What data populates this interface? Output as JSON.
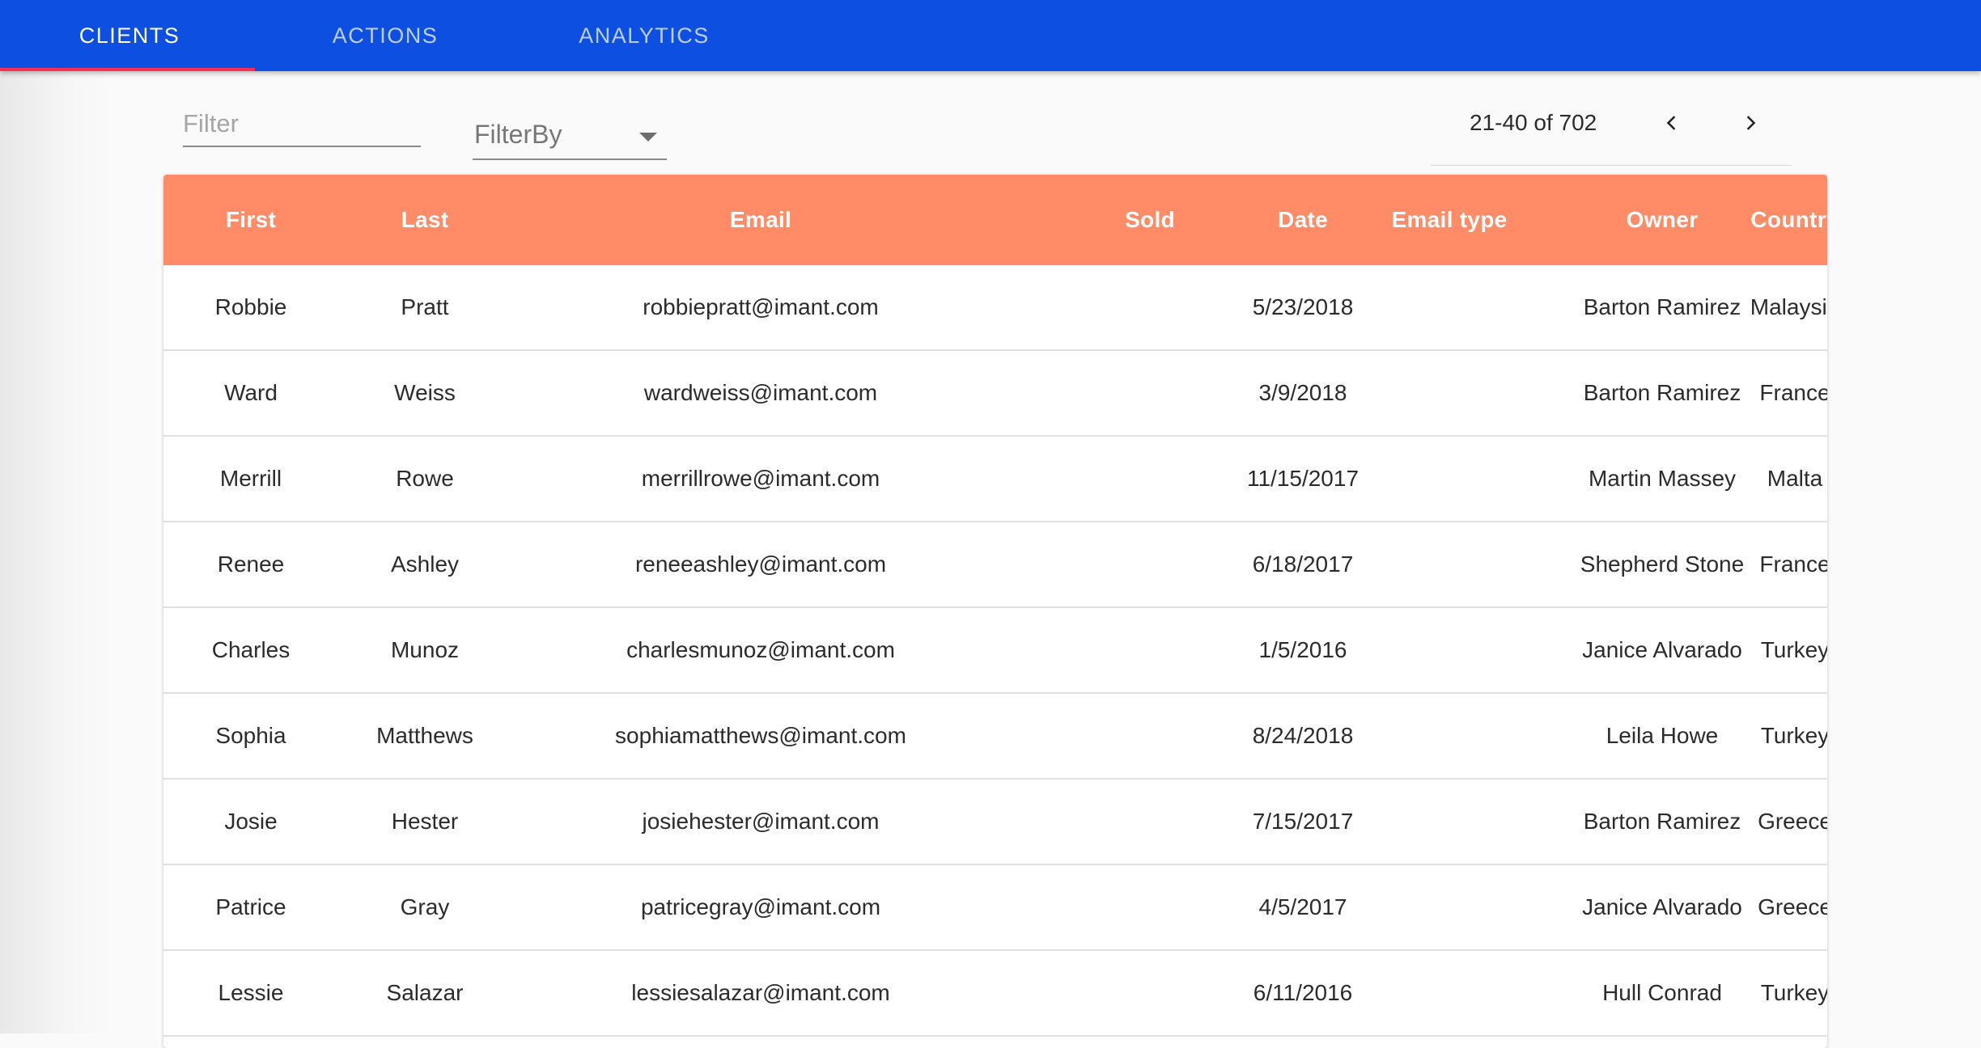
{
  "tabs": [
    {
      "label": "CLIENTS",
      "active": true
    },
    {
      "label": "ACTIONS",
      "active": false
    },
    {
      "label": "ANALYTICS",
      "active": false
    }
  ],
  "controls": {
    "filter_placeholder": "Filter",
    "filter_by_label": "FilterBy",
    "pagination_range": "21-40 of 702"
  },
  "colors": {
    "appbar": "#0d4fe0",
    "tab_indicator": "#ff2d55",
    "table_header": "#ff8c66"
  },
  "icons": {
    "prev": "chevron-left-icon",
    "next": "chevron-right-icon",
    "select": "caret-down-icon"
  },
  "table": {
    "columns": [
      "First",
      "Last",
      "Email",
      "Sold",
      "Date",
      "Email type",
      "Owner",
      "Country"
    ],
    "rows": [
      {
        "first": "Robbie",
        "last": "Pratt",
        "email": "robbiepratt@imant.com",
        "sold": "",
        "date": "5/23/2018",
        "email_type": "",
        "owner": "Barton Ramirez",
        "country": "Malaysia"
      },
      {
        "first": "Ward",
        "last": "Weiss",
        "email": "wardweiss@imant.com",
        "sold": "",
        "date": "3/9/2018",
        "email_type": "",
        "owner": "Barton Ramirez",
        "country": "France"
      },
      {
        "first": "Merrill",
        "last": "Rowe",
        "email": "merrillrowe@imant.com",
        "sold": "",
        "date": "11/15/2017",
        "email_type": "",
        "owner": "Martin Massey",
        "country": "Malta"
      },
      {
        "first": "Renee",
        "last": "Ashley",
        "email": "reneeashley@imant.com",
        "sold": "",
        "date": "6/18/2017",
        "email_type": "",
        "owner": "Shepherd Stone",
        "country": "France"
      },
      {
        "first": "Charles",
        "last": "Munoz",
        "email": "charlesmunoz@imant.com",
        "sold": "",
        "date": "1/5/2016",
        "email_type": "",
        "owner": "Janice Alvarado",
        "country": "Turkey"
      },
      {
        "first": "Sophia",
        "last": "Matthews",
        "email": "sophiamatthews@imant.com",
        "sold": "",
        "date": "8/24/2018",
        "email_type": "",
        "owner": "Leila Howe",
        "country": "Turkey"
      },
      {
        "first": "Josie",
        "last": "Hester",
        "email": "josiehester@imant.com",
        "sold": "",
        "date": "7/15/2017",
        "email_type": "",
        "owner": "Barton Ramirez",
        "country": "Greece"
      },
      {
        "first": "Patrice",
        "last": "Gray",
        "email": "patricegray@imant.com",
        "sold": "",
        "date": "4/5/2017",
        "email_type": "",
        "owner": "Janice Alvarado",
        "country": "Greece"
      },
      {
        "first": "Lessie",
        "last": "Salazar",
        "email": "lessiesalazar@imant.com",
        "sold": "",
        "date": "6/11/2016",
        "email_type": "",
        "owner": "Hull Conrad",
        "country": "Turkey"
      }
    ]
  }
}
